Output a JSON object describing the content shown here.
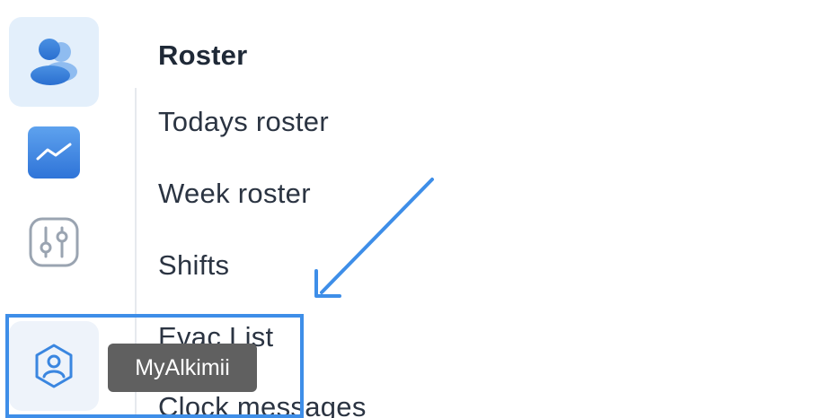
{
  "sidebar": {
    "items": [
      {
        "name": "people-icon",
        "active": true
      },
      {
        "name": "analytics-icon",
        "active": false
      },
      {
        "name": "sliders-icon",
        "active": false
      },
      {
        "name": "profile-hexagon-icon",
        "active": false
      }
    ]
  },
  "menu": {
    "title": "Roster",
    "items": [
      {
        "label": "Todays roster"
      },
      {
        "label": "Week roster"
      },
      {
        "label": "Shifts"
      },
      {
        "label": "Evac List"
      },
      {
        "label": "Clock messages"
      }
    ]
  },
  "tooltip": {
    "text": "MyAlkimii"
  },
  "colors": {
    "accent": "#3e8ee8",
    "active_bg": "#e3effb",
    "tooltip_bg": "#606060",
    "icon_gray": "#9aa4b1"
  }
}
